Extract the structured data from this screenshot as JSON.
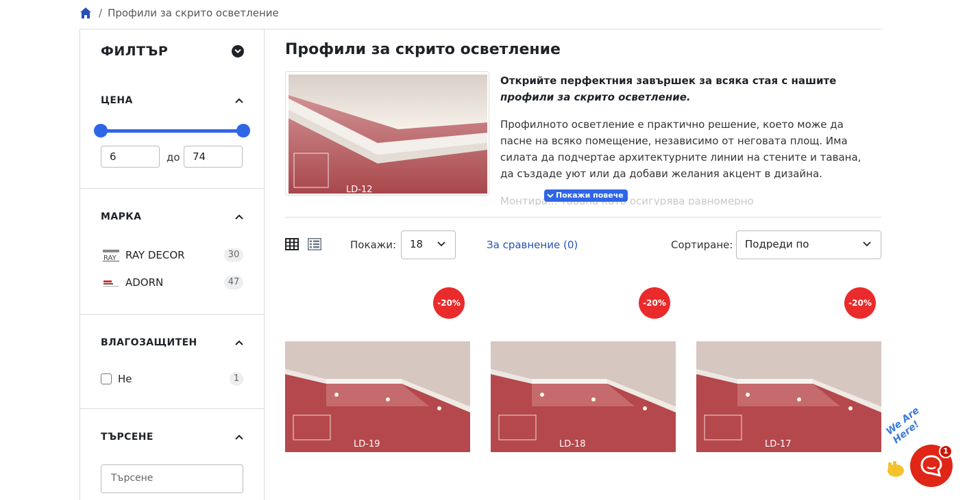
{
  "breadcrumb": {
    "separator": "/",
    "current": "Профили за скрито осветление"
  },
  "sidebar": {
    "filter_title": "ФИЛТЪР",
    "price": {
      "title": "ЦЕНА",
      "min": "6",
      "max": "74",
      "between": "до"
    },
    "brand": {
      "title": "МАРКА",
      "items": [
        {
          "name": "RAY DECOR",
          "count": "30"
        },
        {
          "name": "ADORN",
          "count": "47"
        }
      ]
    },
    "waterproof": {
      "title": "ВЛАГОЗАЩИТЕН",
      "items": [
        {
          "name": "Не",
          "count": "1"
        }
      ]
    },
    "search": {
      "title": "ТЪРСЕНЕ",
      "placeholder": "Търсене"
    }
  },
  "main": {
    "title": "Профили за скрито осветление",
    "hero_caption": "LD-12",
    "desc_lead_plain": "Открийте перфектния завършек за всяка стая с нашите ",
    "desc_lead_italic": "профили за скрито осветление.",
    "desc_para": "Профилното осветление е практично решение, което може да пасне на всяко помещение, независимо от неговата площ. Има силата да подчертае архитектурните линии на стените и тавана, да създаде уют или да добави желания акцент в дизайна.",
    "desc_fade": "Монтира... тавана като осигурява равномерно",
    "show_more": "Покажи повече"
  },
  "toolbar": {
    "show_label": "Покажи:",
    "per_page": "18",
    "compare": "За сравнение (0)",
    "sort_label": "Сортиране:",
    "sort_value": "Подреди по"
  },
  "products": [
    {
      "code": "LD-19",
      "discount": "-20%"
    },
    {
      "code": "LD-18",
      "discount": "-20%"
    },
    {
      "code": "LD-17",
      "discount": "-20%"
    }
  ],
  "chat": {
    "badge": "1",
    "tagline": "We Are Here!"
  },
  "colors": {
    "accent": "#2f66e5",
    "discount": "#ea2b2b",
    "chat": "#e02617"
  }
}
